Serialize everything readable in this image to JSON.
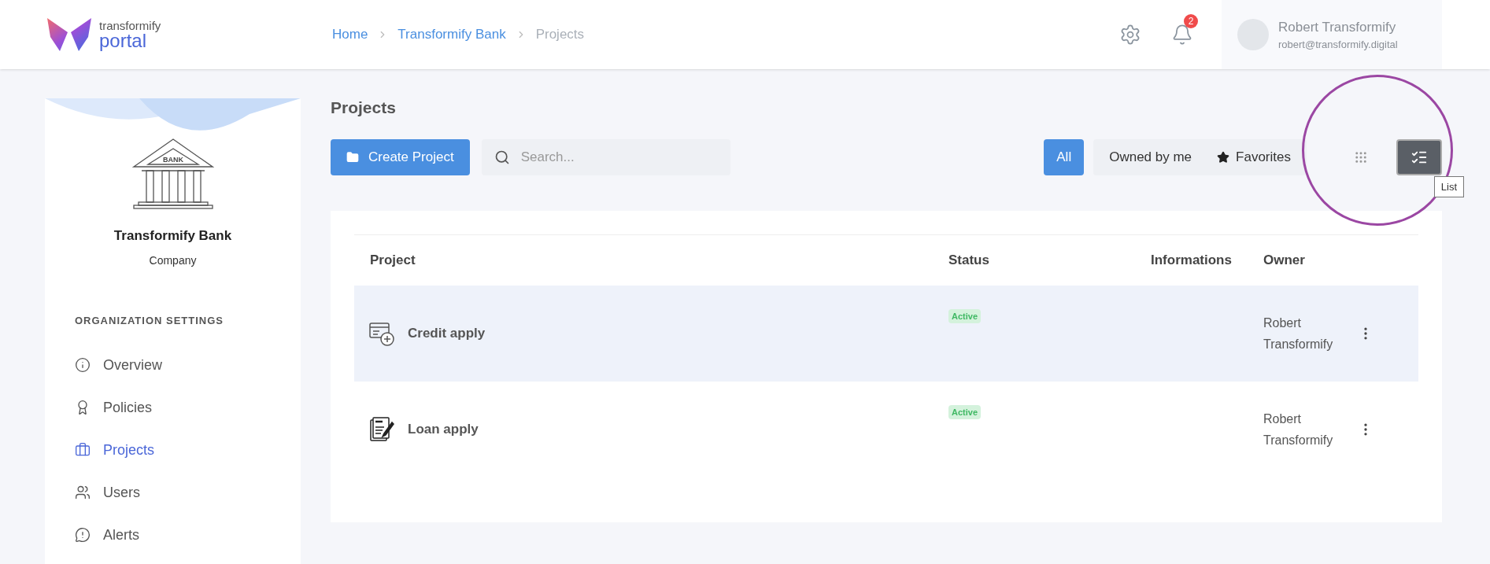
{
  "header": {
    "logo": {
      "top": "transformify",
      "bottom": "portal"
    },
    "breadcrumb": [
      {
        "label": "Home",
        "current": false
      },
      {
        "label": "Transformify Bank",
        "current": false
      },
      {
        "label": "Projects",
        "current": true
      }
    ],
    "notifications": {
      "count": "2"
    },
    "user": {
      "name": "Robert Transformify",
      "email": "robert@transformify.digital"
    }
  },
  "sidebar": {
    "bank_sign": "BANK",
    "company": "Transformify Bank",
    "company_type": "Company",
    "section": "ORGANIZATION SETTINGS",
    "items": [
      {
        "label": "Overview",
        "selected": false
      },
      {
        "label": "Policies",
        "selected": false
      },
      {
        "label": "Projects",
        "selected": true
      },
      {
        "label": "Users",
        "selected": false
      },
      {
        "label": "Alerts",
        "selected": false
      }
    ]
  },
  "page": {
    "title": "Projects",
    "create_button": "Create Project",
    "search": {
      "placeholder": "Search..."
    },
    "filters": [
      {
        "label": "All",
        "selected": true,
        "kind": "plain"
      },
      {
        "label": "Owned by me",
        "selected": false,
        "kind": "plain"
      },
      {
        "label": "Favorites",
        "selected": false,
        "kind": "favorites"
      }
    ],
    "views": [
      {
        "kind": "grid",
        "selected": false
      },
      {
        "kind": "list",
        "selected": true
      }
    ],
    "tooltip": "List"
  },
  "table": {
    "columns": [
      "Project",
      "Status",
      "Informations",
      "Owner"
    ],
    "rows": [
      {
        "name": "Credit apply",
        "status": "Active",
        "owner": "Robert Transformify",
        "selected": true
      },
      {
        "name": "Loan apply",
        "status": "Active",
        "owner": "Robert Transformify",
        "selected": false
      }
    ]
  }
}
